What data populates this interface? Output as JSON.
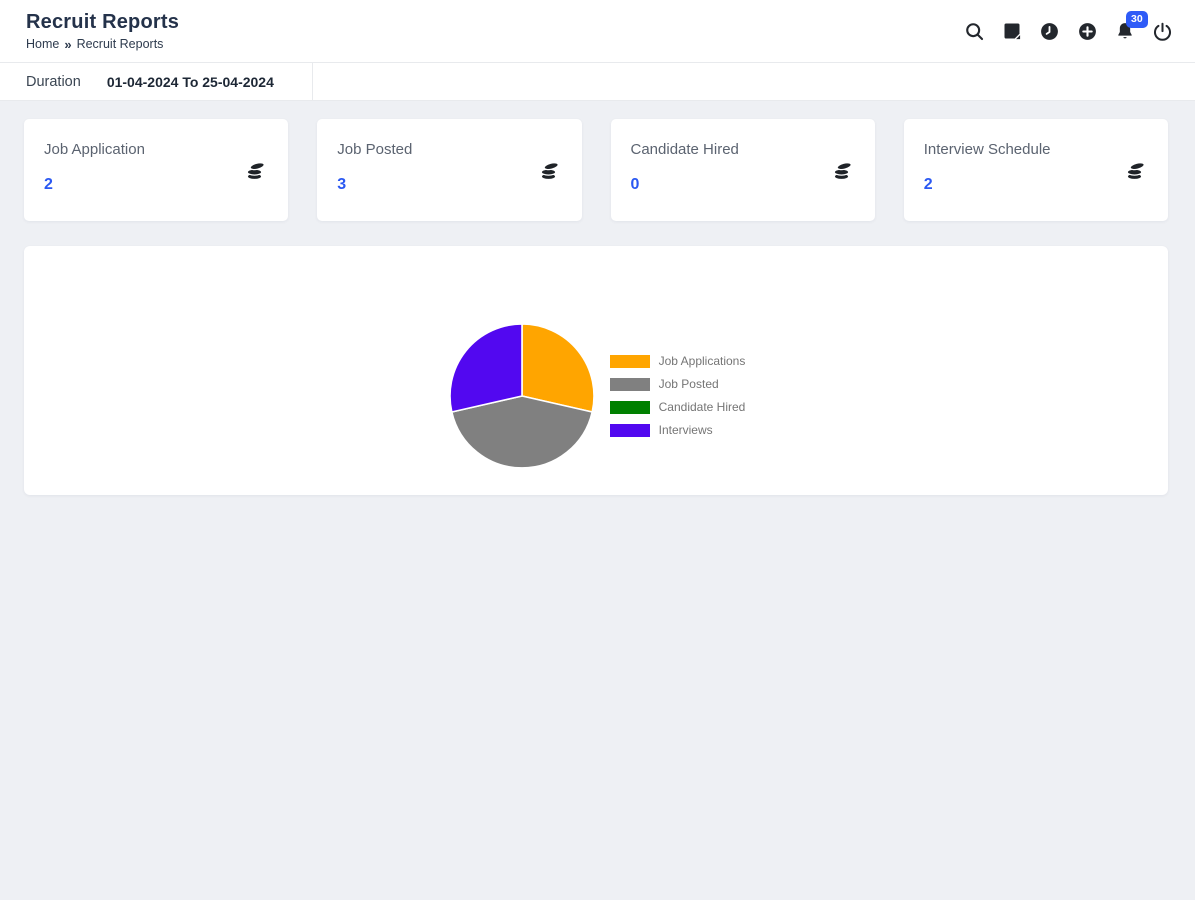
{
  "header": {
    "title": "Recruit Reports",
    "breadcrumb": {
      "home": "Home",
      "separator": "»",
      "current": "Recruit Reports"
    },
    "notification_count": "30",
    "icons": [
      "search-icon",
      "note-icon",
      "clock-icon",
      "plus-circle-icon",
      "bell-icon",
      "power-icon"
    ]
  },
  "filter_bar": {
    "duration_label": "Duration",
    "duration_value": "01-04-2024 To 25-04-2024"
  },
  "stat_cards": [
    {
      "title": "Job Application",
      "value": "2",
      "icon": "stack-icon"
    },
    {
      "title": "Job Posted",
      "value": "3",
      "icon": "stack-icon"
    },
    {
      "title": "Candidate Hired",
      "value": "0",
      "icon": "stack-icon"
    },
    {
      "title": "Interview Schedule",
      "value": "2",
      "icon": "stack-icon"
    }
  ],
  "chart_data": {
    "type": "pie",
    "title": "",
    "labels": [
      "Job Applications",
      "Job Posted",
      "Candidate Hired",
      "Interviews"
    ],
    "values": [
      2,
      3,
      0,
      2
    ],
    "colors": [
      "#FFA500",
      "#808080",
      "#008000",
      "#5208F0"
    ],
    "total": 7,
    "start_angle_deg": -90,
    "direction": "clockwise",
    "legend_position": "right",
    "slice_border_color": "#ffffff"
  },
  "colors": {
    "accent_blue": "#2a58f2",
    "badge_blue": "#2e5bf7",
    "page_background": "#eef0f4",
    "card_background": "#ffffff",
    "header_text": "#24324a",
    "card_title_text": "#5b6370",
    "legend_label_text": "#757575",
    "icon_dark": "#23272d"
  }
}
